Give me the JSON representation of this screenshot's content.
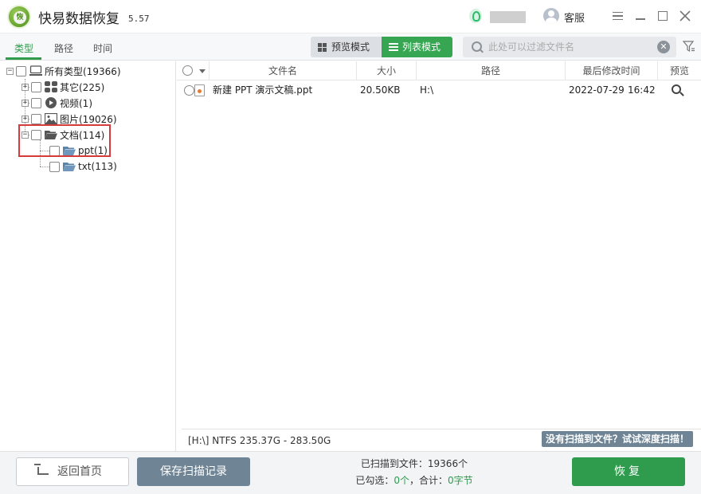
{
  "app": {
    "title": "快易数据恢复",
    "version": "5.57"
  },
  "titlebar": {
    "service_label": "客服"
  },
  "tabs": [
    {
      "label": "类型"
    },
    {
      "label": "路径"
    },
    {
      "label": "时间"
    }
  ],
  "modes": {
    "preview": "预览模式",
    "list": "列表模式"
  },
  "search": {
    "placeholder": "此处可以过滤文件名",
    "value": ""
  },
  "tree": [
    {
      "label": "所有类型(19366)"
    },
    {
      "label": "其它(225)"
    },
    {
      "label": "视频(1)"
    },
    {
      "label": "图片(19026)"
    },
    {
      "label": "文档(114)"
    },
    {
      "label": "ppt(1)"
    },
    {
      "label": "txt(113)"
    }
  ],
  "columns": {
    "name": "文件名",
    "size": "大小",
    "path": "路径",
    "modified": "最后修改时间",
    "preview": "预览"
  },
  "files": [
    {
      "name": "新建 PPT 演示文稿.ppt",
      "size": "20.50KB",
      "path": "H:\\",
      "date": "2022-07-29",
      "time": "16:42"
    }
  ],
  "status": {
    "disk_info": "[H:\\] NTFS 235.37G - 283.50G",
    "deep_scan": "没有扫描到文件？试试深度扫描！"
  },
  "bottom": {
    "home_label": "返回首页",
    "save_label": "保存扫描记录",
    "scanned_prefix": "已扫描到文件：",
    "scanned_count": "19366个",
    "checked_prefix": "已勾选：",
    "checked_count": "0个",
    "total_prefix": "，合计：",
    "total_size": "0字节",
    "recover_label": "恢复"
  },
  "colors": {
    "accent": "#2e9b4d",
    "secondary_button": "#6f8596",
    "highlight": "#d63b3b"
  }
}
